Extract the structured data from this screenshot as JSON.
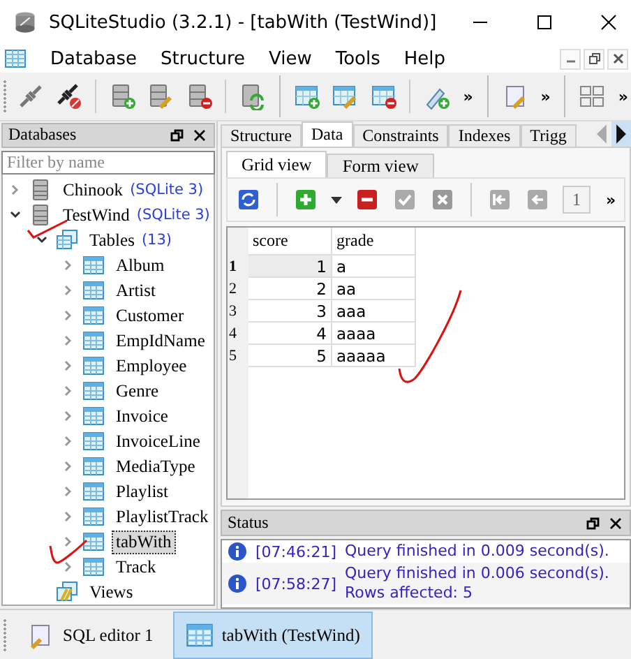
{
  "window": {
    "title": "SQLiteStudio (3.2.1) - [tabWith (TestWind)]"
  },
  "menu": [
    "Database",
    "Structure",
    "View",
    "Tools",
    "Help"
  ],
  "toolbar": {
    "overflow": [
      "»",
      "»",
      "»"
    ]
  },
  "databases_panel": {
    "title": "Databases",
    "filter": {
      "placeholder": "Filter by name"
    },
    "tree": [
      {
        "label": "Chinook",
        "suffix": "(SQLite 3)",
        "kind": "database",
        "expanded": false,
        "selected": false
      },
      {
        "label": "TestWind",
        "suffix": "(SQLite 3)",
        "kind": "database",
        "expanded": true,
        "selected": false,
        "children": [
          {
            "label": "Tables",
            "suffix": "(13)",
            "kind": "tables",
            "expanded": true,
            "selected": false,
            "children": [
              {
                "label": "Album",
                "kind": "table",
                "expanded": false,
                "selected": false
              },
              {
                "label": "Artist",
                "kind": "table",
                "expanded": false,
                "selected": false
              },
              {
                "label": "Customer",
                "kind": "table",
                "expanded": false,
                "selected": false
              },
              {
                "label": "EmpIdName",
                "kind": "table",
                "expanded": false,
                "selected": false
              },
              {
                "label": "Employee",
                "kind": "table",
                "expanded": false,
                "selected": false
              },
              {
                "label": "Genre",
                "kind": "table",
                "expanded": false,
                "selected": false
              },
              {
                "label": "Invoice",
                "kind": "table",
                "expanded": false,
                "selected": false
              },
              {
                "label": "InvoiceLine",
                "kind": "table",
                "expanded": false,
                "selected": false
              },
              {
                "label": "MediaType",
                "kind": "table",
                "expanded": false,
                "selected": false
              },
              {
                "label": "Playlist",
                "kind": "table",
                "expanded": false,
                "selected": false
              },
              {
                "label": "PlaylistTrack",
                "kind": "table",
                "expanded": false,
                "selected": false
              },
              {
                "label": "tabWith",
                "kind": "table",
                "expanded": false,
                "selected": true
              },
              {
                "label": "Track",
                "kind": "table",
                "expanded": false,
                "selected": false
              }
            ]
          },
          {
            "label": "Views",
            "kind": "views",
            "selected": false
          }
        ]
      }
    ]
  },
  "tabs": [
    {
      "label": "Structure",
      "selected": false
    },
    {
      "label": "Data",
      "selected": true
    },
    {
      "label": "Constraints",
      "selected": false
    },
    {
      "label": "Indexes",
      "selected": false
    },
    {
      "label": "Trigg",
      "selected": false
    }
  ],
  "subtabs": [
    {
      "label": "Grid view",
      "selected": true
    },
    {
      "label": "Form view",
      "selected": false
    }
  ],
  "grid_toolbar": {
    "page": "1",
    "overflow": "»"
  },
  "grid": {
    "columns": [
      "score",
      "grade"
    ],
    "rows": [
      {
        "number": "1",
        "score": "1",
        "grade": "a",
        "selected": true
      },
      {
        "number": "2",
        "score": "2",
        "grade": "aa",
        "selected": false
      },
      {
        "number": "3",
        "score": "3",
        "grade": "aaa",
        "selected": false
      },
      {
        "number": "4",
        "score": "4",
        "grade": "aaaa",
        "selected": false
      },
      {
        "number": "5",
        "score": "5",
        "grade": "aaaaa",
        "selected": false
      }
    ]
  },
  "status_panel": {
    "title": "Status",
    "messages": [
      {
        "time": "[07:46:21]",
        "lines": [
          "Query finished in 0.009 second(s)."
        ]
      },
      {
        "time": "[07:58:27]",
        "lines": [
          "Query finished in 0.006 second(s).",
          "Rows affected: 5"
        ]
      }
    ]
  },
  "taskbar": [
    {
      "label": "SQL editor 1",
      "kind": "editor",
      "selected": false
    },
    {
      "label": "tabWith (TestWind)",
      "kind": "table",
      "selected": true
    }
  ]
}
